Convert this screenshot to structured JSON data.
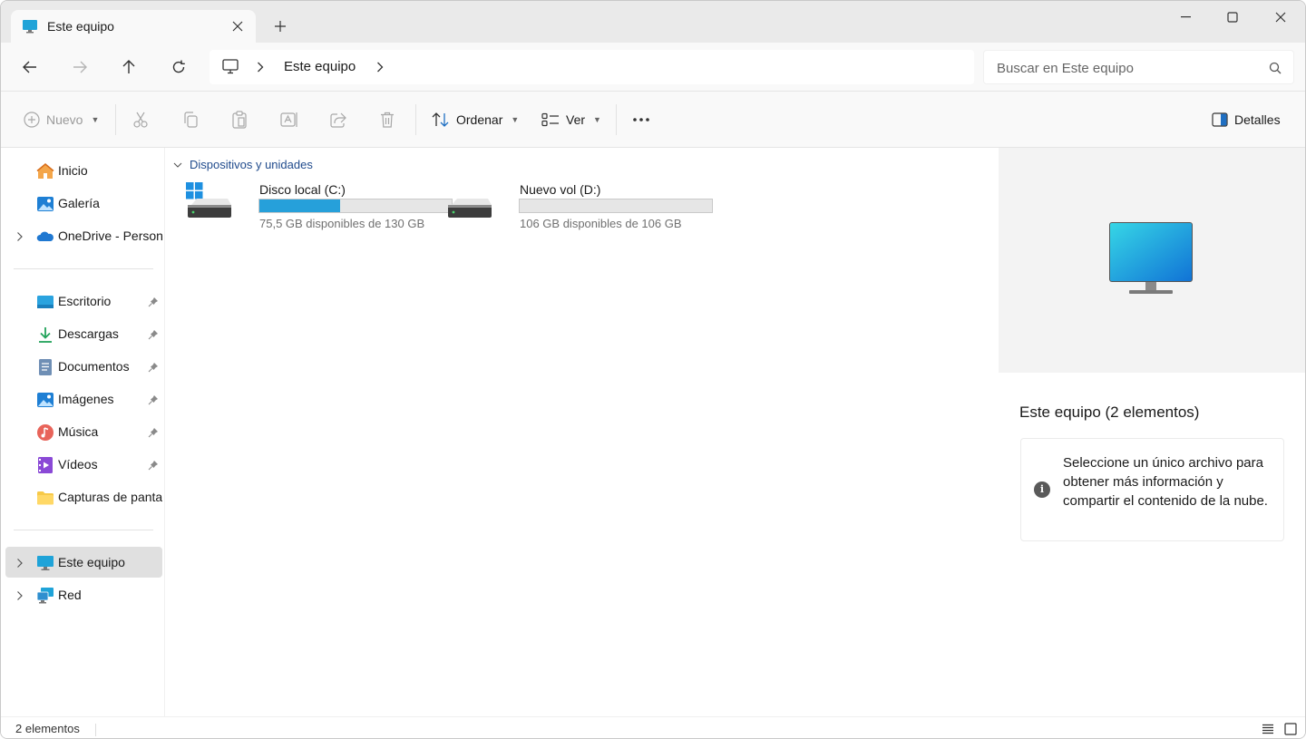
{
  "tab": {
    "title": "Este equipo"
  },
  "address": {
    "current": "Este equipo"
  },
  "search": {
    "placeholder": "Buscar en Este equipo"
  },
  "toolbar": {
    "new_label": "Nuevo",
    "sort_label": "Ordenar",
    "view_label": "Ver",
    "details_label": "Detalles"
  },
  "sidebar": {
    "top_items": [
      {
        "label": "Inicio",
        "icon": "home-icon"
      },
      {
        "label": "Galería",
        "icon": "gallery-icon"
      },
      {
        "label": "OneDrive - Persona",
        "icon": "onedrive-icon"
      }
    ],
    "pinned": [
      {
        "label": "Escritorio",
        "icon": "desktop-icon"
      },
      {
        "label": "Descargas",
        "icon": "download-icon"
      },
      {
        "label": "Documentos",
        "icon": "documents-icon"
      },
      {
        "label": "Imágenes",
        "icon": "images-icon"
      },
      {
        "label": "Música",
        "icon": "music-icon"
      },
      {
        "label": "Vídeos",
        "icon": "videos-icon"
      },
      {
        "label": "Capturas de pantall",
        "icon": "folder-icon"
      }
    ],
    "bottom_items": [
      {
        "label": "Este equipo",
        "icon": "computer-icon",
        "selected": true
      },
      {
        "label": "Red",
        "icon": "network-icon"
      }
    ]
  },
  "content": {
    "group_header": "Dispositivos y unidades",
    "drives": [
      {
        "name": "Disco local (C:)",
        "free_text": "75,5 GB disponibles de 130 GB",
        "used_fraction": 0.42
      },
      {
        "name": "Nuevo vol (D:)",
        "free_text": "106 GB disponibles de 106 GB",
        "used_fraction": 0.0
      }
    ]
  },
  "details": {
    "title": "Este equipo (2 elementos)",
    "info": "Seleccione un único archivo para obtener más información y compartir el contenido de la nube."
  },
  "status": {
    "items_text": "2 elementos"
  },
  "colors": {
    "accent": "#26a0da",
    "link": "#1f4a8c",
    "selected_bg": "#e0e0e0"
  }
}
